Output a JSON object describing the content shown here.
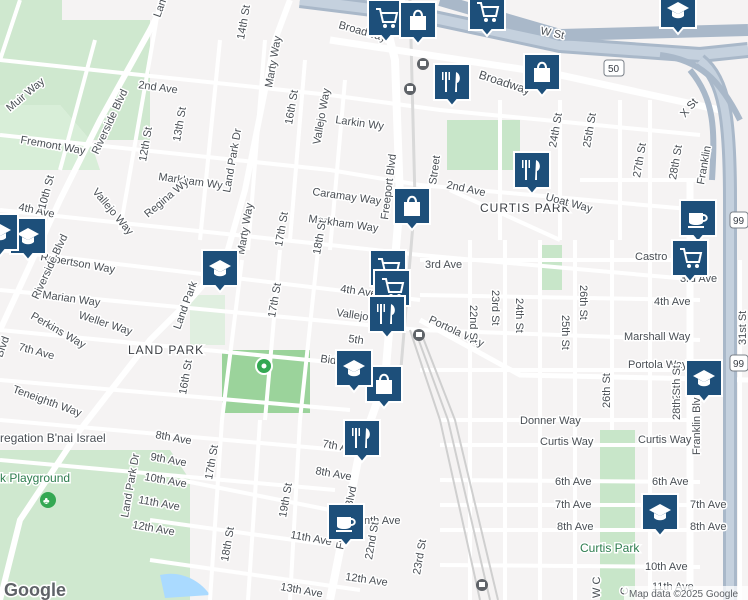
{
  "map": {
    "area_labels": [
      "CURTIS PARK",
      "LAND PARK"
    ],
    "park_labels": [
      "Curtis Park",
      "k Playground"
    ],
    "place_labels": [
      "regation B'nai Israel"
    ],
    "highway_shields": [
      "50",
      "99",
      "99"
    ],
    "street_labels": [
      "W St",
      "Broadway",
      "X St",
      "Broadway",
      "2nd Ave",
      "Larkin Wy",
      "Fremont Way",
      "Markham Wy",
      "Caramay Way",
      "Markham Way",
      "Freeport Blvd",
      "Street",
      "2nd Ave",
      "Vallejo Way",
      "Regina Wy",
      "4th Ave",
      "Robertson Way",
      "Marian Way",
      "Weller Way",
      "Perkins Way",
      "7th Ave",
      "Teneighth Way",
      "3rd Ave",
      "4th Ave",
      "Vallejo",
      "5th",
      "Bid",
      "Portola Way",
      "22nd St",
      "23rd St",
      "24th St",
      "25th St",
      "26th St",
      "Castro",
      "3rd Ave",
      "4th Ave",
      "Marshall Way",
      "Portola Way",
      "Donner Way",
      "Curtis Way",
      "Curtis Way",
      "8th Ave",
      "9th Ave",
      "10th Ave",
      "11th Ave",
      "12th Ave",
      "7th Ave",
      "8th Ave",
      "11th Ave",
      "12th Ave",
      "13th Ave",
      "Fre",
      "Blvd",
      "nth Ave",
      "22nd St",
      "23rd St",
      "19th St",
      "18th St",
      "17th St",
      "16th St",
      "Land Park Dr",
      "Land Park Dr",
      "Land Park",
      "Marty Way",
      "17th St",
      "18th St",
      "17th St",
      "16th St",
      "Marty Way",
      "14th St",
      "13th St",
      "12th St",
      "10th St",
      "Riverside Blvd",
      "Riverside Blvd",
      "Muir Way",
      "Vallejo Way",
      "Land Park Dr",
      "Blvd",
      "24th St",
      "25th St",
      "27th St",
      "28th St",
      "Franklin",
      "Franklin Blvd",
      "26th St",
      "27th St",
      "28th St",
      "31st St",
      "6th Ave",
      "6th Ave",
      "7th Ave",
      "7th Ave",
      "8th Ave",
      "8th Ave",
      "10th Ave",
      "11th Ave",
      "Uoat Way",
      "C",
      "W C"
    ],
    "pins": [
      {
        "type": "shopping-cart-icon"
      },
      {
        "type": "shopping-bag-icon"
      },
      {
        "type": "shopping-cart-icon"
      },
      {
        "type": "school-icon"
      },
      {
        "type": "shopping-bag-icon"
      },
      {
        "type": "restaurant-icon"
      },
      {
        "type": "shopping-bag-icon"
      },
      {
        "type": "restaurant-icon"
      },
      {
        "type": "coffee-icon"
      },
      {
        "type": "school-icon"
      },
      {
        "type": "school-icon"
      },
      {
        "type": "shopping-cart-icon"
      },
      {
        "type": "shopping-cart-icon"
      },
      {
        "type": "restaurant-icon"
      },
      {
        "type": "school-icon"
      },
      {
        "type": "shopping-bag-icon"
      },
      {
        "type": "restaurant-icon"
      },
      {
        "type": "coffee-icon"
      },
      {
        "type": "shopping-cart-icon"
      },
      {
        "type": "school-icon"
      },
      {
        "type": "school-icon"
      },
      {
        "type": "school-icon"
      }
    ],
    "pin_color": "#1d4f7a",
    "park_color": "#c8e6c9",
    "freeway_color": "#a9b8c9"
  },
  "attribution": {
    "logo": "Google",
    "text": "Map data ©2025 Google"
  }
}
